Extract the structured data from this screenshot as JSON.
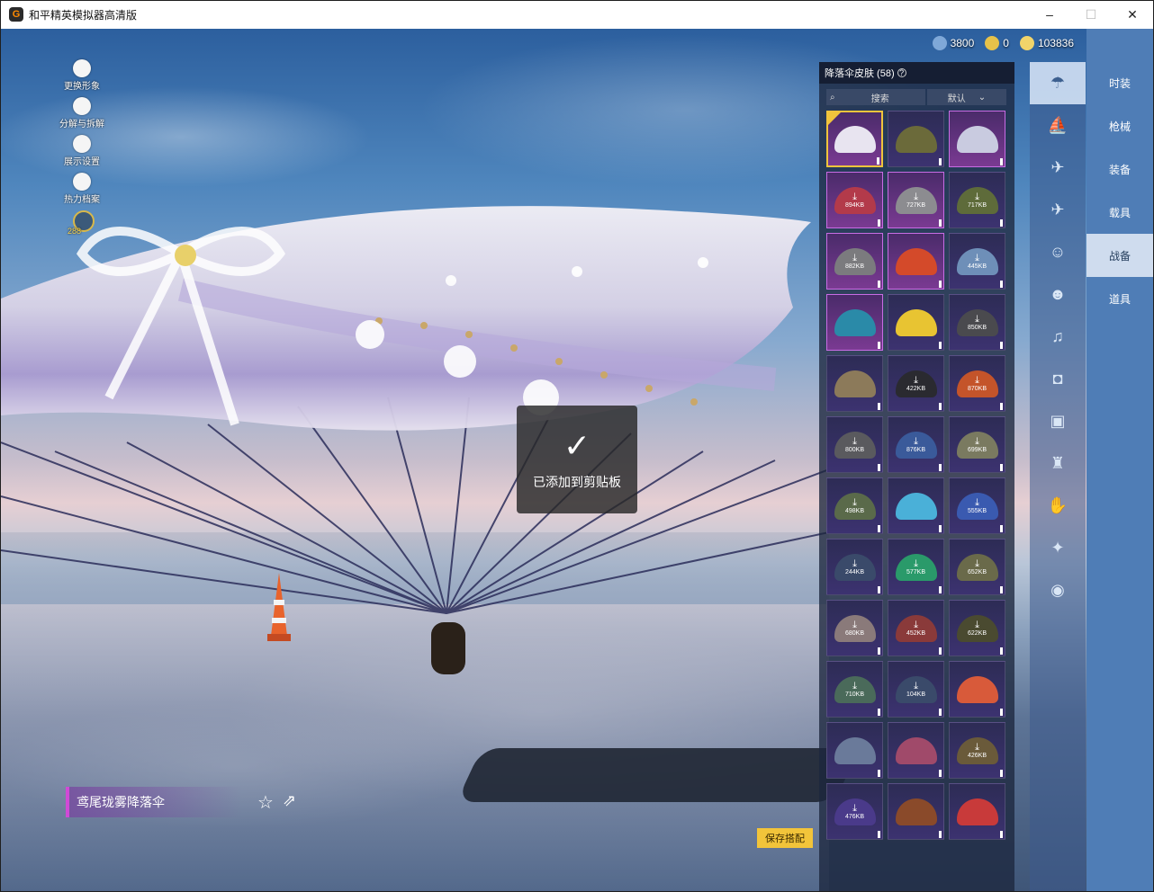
{
  "window": {
    "title": "和平精英模拟器高清版",
    "logo_letter": "G",
    "min": "–",
    "max": "☐",
    "close": "✕"
  },
  "currency": [
    {
      "name": "uc-coin",
      "value": "3800",
      "color": "#7fa8d8"
    },
    {
      "name": "bp-coin",
      "value": "0",
      "color": "#e7c24a"
    },
    {
      "name": "gold-coin",
      "value": "103836",
      "color": "#f1d46a"
    }
  ],
  "close_label": "✕",
  "left_menu": {
    "items": [
      {
        "label": "更换形象"
      },
      {
        "label": "分解与拆解"
      },
      {
        "label": "展示设置"
      },
      {
        "label": "热力档案"
      }
    ],
    "level": "288"
  },
  "skin_panel": {
    "title": "降落伞皮肤 (58)",
    "help": "?",
    "search_icon": "⌕",
    "search_placeholder": "搜索",
    "sort_label": "默认",
    "sort_caret": "⌄",
    "download_icon": "⤓",
    "items": [
      {
        "size": "",
        "rare": true,
        "selected": true,
        "color": "#e8e4f0"
      },
      {
        "size": "",
        "rare": false,
        "color": "#6b6a3a"
      },
      {
        "size": "",
        "rare": true,
        "color": "#c9cbe0"
      },
      {
        "size": "894KB",
        "rare": true,
        "color": "#b33a4a"
      },
      {
        "size": "727KB",
        "rare": true,
        "color": "#8c8c90"
      },
      {
        "size": "717KB",
        "rare": false,
        "color": "#5e6b3a"
      },
      {
        "size": "882KB",
        "rare": true,
        "color": "#7b7b7e"
      },
      {
        "size": "",
        "rare": true,
        "color": "#d44a2a"
      },
      {
        "size": "445KB",
        "rare": false,
        "color": "#6e8fb8"
      },
      {
        "size": "",
        "rare": true,
        "color": "#2a8aa8"
      },
      {
        "size": "",
        "rare": false,
        "color": "#e8c432"
      },
      {
        "size": "850KB",
        "rare": false,
        "color": "#4a4a4e"
      },
      {
        "size": "",
        "rare": false,
        "color": "#8c7a5a"
      },
      {
        "size": "422KB",
        "rare": false,
        "color": "#2a2a30"
      },
      {
        "size": "870KB",
        "rare": false,
        "color": "#c4542a"
      },
      {
        "size": "800KB",
        "rare": false,
        "color": "#5a5a5e"
      },
      {
        "size": "876KB",
        "rare": false,
        "color": "#3a5a9a"
      },
      {
        "size": "699KB",
        "rare": false,
        "color": "#7a7a60"
      },
      {
        "size": "498KB",
        "rare": false,
        "color": "#5a6a4a"
      },
      {
        "size": "",
        "rare": false,
        "color": "#4ab0d8"
      },
      {
        "size": "555KB",
        "rare": false,
        "color": "#3a5ab0"
      },
      {
        "size": "244KB",
        "rare": false,
        "color": "#3a4a6a"
      },
      {
        "size": "577KB",
        "rare": false,
        "color": "#2a9a6a"
      },
      {
        "size": "652KB",
        "rare": false,
        "color": "#6a6a4a"
      },
      {
        "size": "680KB",
        "rare": false,
        "color": "#8a7a7a"
      },
      {
        "size": "452KB",
        "rare": false,
        "color": "#8a3a3a"
      },
      {
        "size": "622KB",
        "rare": false,
        "color": "#4a4a30"
      },
      {
        "size": "710KB",
        "rare": false,
        "color": "#4a6a5a"
      },
      {
        "size": "104KB",
        "rare": false,
        "color": "#3a4a6a"
      },
      {
        "size": "",
        "rare": false,
        "color": "#d85a3a"
      },
      {
        "size": "",
        "rare": false,
        "color": "#6a7a9a"
      },
      {
        "size": "",
        "rare": false,
        "color": "#a04a6a"
      },
      {
        "size": "426KB",
        "rare": false,
        "color": "#6a5a3a"
      },
      {
        "size": "476KB",
        "rare": false,
        "color": "#4a3a8a"
      },
      {
        "size": "",
        "rare": false,
        "color": "#8a4a2a"
      },
      {
        "size": "",
        "rare": false,
        "color": "#c83a3a"
      }
    ]
  },
  "category_rail": [
    {
      "icon": "parachute-icon",
      "glyph": "☂",
      "active": true
    },
    {
      "icon": "boat-icon",
      "glyph": "⛵"
    },
    {
      "icon": "drone-icon",
      "glyph": "✈"
    },
    {
      "icon": "plane-icon",
      "glyph": "✈"
    },
    {
      "icon": "emote-icon",
      "glyph": "☺"
    },
    {
      "icon": "companion-icon",
      "glyph": "☻"
    },
    {
      "icon": "sound-icon",
      "glyph": "♫"
    },
    {
      "icon": "badge-icon",
      "glyph": "◘"
    },
    {
      "icon": "picture-icon",
      "glyph": "▣"
    },
    {
      "icon": "extinguisher-icon",
      "glyph": "♜"
    },
    {
      "icon": "hand-icon",
      "glyph": "✋"
    },
    {
      "icon": "magic-wand-icon",
      "glyph": "✦"
    },
    {
      "icon": "ufo-icon",
      "glyph": "◉"
    }
  ],
  "tabs": [
    {
      "label": "时装"
    },
    {
      "label": "枪械"
    },
    {
      "label": "装备"
    },
    {
      "label": "载具"
    },
    {
      "label": "战备",
      "active": true
    },
    {
      "label": "道具"
    }
  ],
  "toast": {
    "icon": "✓",
    "text": "已添加到剪贴板"
  },
  "item_name": "鸢尾珑雾降落伞",
  "favorite_icon": "☆",
  "share_icon": "⇗",
  "save_button": "保存搭配"
}
